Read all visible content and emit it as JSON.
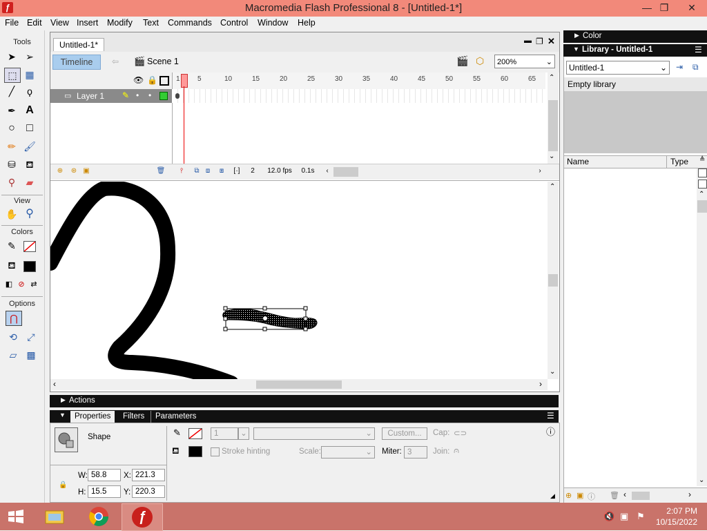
{
  "app": {
    "title": "Macromedia Flash Professional 8 - [Untitled-1*]",
    "window_controls": {
      "minimize": "—",
      "restore": "❐",
      "close": "✕"
    }
  },
  "menu": [
    "File",
    "Edit",
    "View",
    "Insert",
    "Modify",
    "Text",
    "Commands",
    "Control",
    "Window",
    "Help"
  ],
  "tools": {
    "header": "Tools",
    "view_header": "View",
    "colors_header": "Colors",
    "options_header": "Options"
  },
  "document": {
    "tab_label": "Untitled-1*",
    "timeline_button": "Timeline",
    "scene_label": "Scene 1",
    "zoom": "200%"
  },
  "timeline": {
    "layer_name": "Layer 1",
    "ruler_ticks": [
      "1",
      "5",
      "10",
      "15",
      "20",
      "25",
      "30",
      "35",
      "40",
      "45",
      "50",
      "55",
      "60",
      "65"
    ],
    "current_frame": "2",
    "fps": "12.0 fps",
    "elapsed": "0.1s"
  },
  "panels": {
    "actions_label": "Actions",
    "properties_tab": "Properties",
    "filters_tab": "Filters",
    "parameters_tab": "Parameters"
  },
  "properties": {
    "object_type": "Shape",
    "stroke_height": "1",
    "custom_button": "Custom...",
    "cap_label": "Cap:",
    "stroke_hinting_label": "Stroke hinting",
    "scale_label": "Scale:",
    "miter_label": "Miter:",
    "miter_value": "3",
    "join_label": "Join:",
    "w_label": "W:",
    "w_value": "58.8",
    "h_label": "H:",
    "h_value": "15.5",
    "x_label": "X:",
    "x_value": "221.3",
    "y_label": "Y:",
    "y_value": "220.3"
  },
  "right_panels": {
    "color_label": "Color",
    "library_label": "Library - Untitled-1",
    "library_select": "Untitled-1",
    "empty_library": "Empty library",
    "col_name": "Name",
    "col_type": "Type"
  },
  "taskbar": {
    "time": "2:07 PM",
    "date": "10/15/2022"
  },
  "colors": {
    "titlebar": "#f2897a",
    "taskbar": "#c9736a",
    "timeline_button": "#a9cdee"
  }
}
